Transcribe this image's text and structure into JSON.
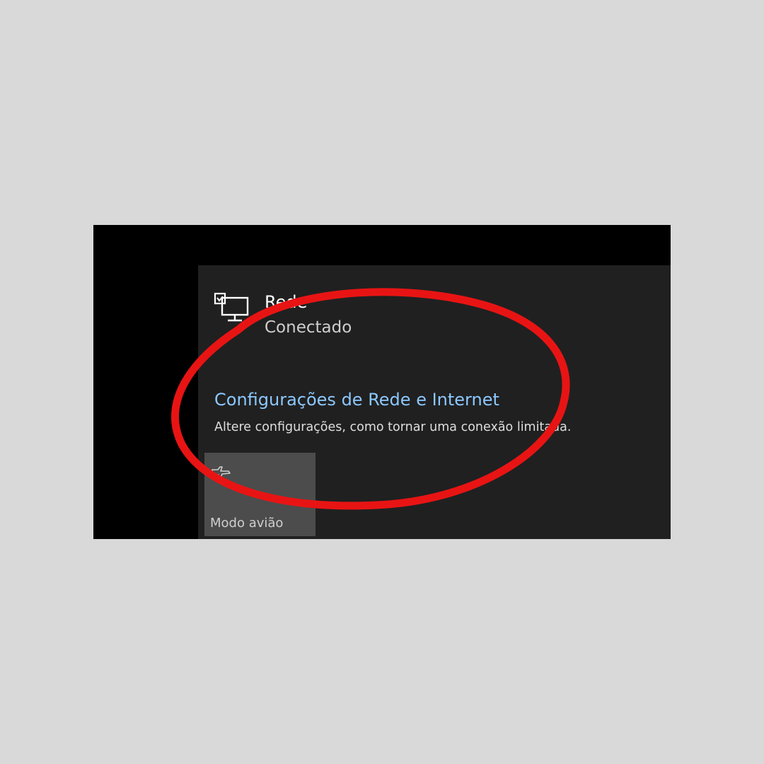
{
  "network": {
    "name": "Rede",
    "status": "Conectado",
    "icon": "wired-network-icon"
  },
  "settings": {
    "link_label": "Configurações de Rede e Internet",
    "description": "Altere configurações, como tornar uma conexão limitada."
  },
  "quick_actions": {
    "airplane_label": "Modo avião",
    "airplane_icon": "airplane-icon"
  },
  "annotation": {
    "color": "#e81414"
  },
  "colors": {
    "link": "#8cc8ff",
    "flyout_bg": "#202020",
    "tile_bg": "#4c4c4c",
    "page_bg": "#d9d9d9"
  }
}
